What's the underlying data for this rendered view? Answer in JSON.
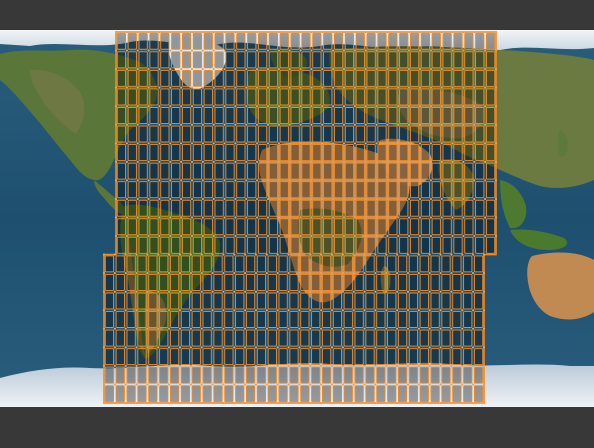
{
  "viewport": {
    "background": "#383838",
    "description_free": true
  },
  "map": {
    "texture": "world-satellite-equirectangular",
    "ocean_color": "#1f4e6e",
    "deep_ocean_color": "#163f5c",
    "ice_color": "#e9eef3",
    "land_green": "#5c7a3a",
    "land_desert": "#c8935a",
    "land_dark": "#4a6233"
  },
  "mesh_overlay": {
    "edge_color": "#f08a24",
    "face_fill": "#000000",
    "face_opacity": 0.35,
    "vertex_color": "#ff9a3c",
    "selected": true,
    "top_columns": 35,
    "bottom_columns": 35,
    "rows": 20
  }
}
